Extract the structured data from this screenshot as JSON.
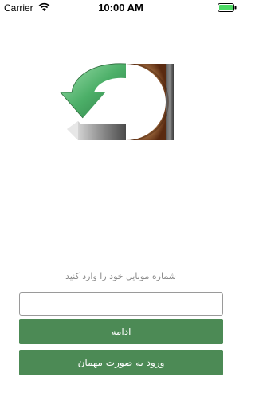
{
  "status_bar": {
    "carrier": "Carrier",
    "time": "10:00 AM",
    "battery_color": "#4cd964"
  },
  "login": {
    "prompt": "شماره موبایل خود را وارد کنید",
    "phone_value": "",
    "continue_label": "ادامه",
    "guest_label": "ورود به صورت مهمان",
    "button_color": "#4c8a55"
  },
  "logo": {
    "icon": "sync-arrows-logo"
  }
}
